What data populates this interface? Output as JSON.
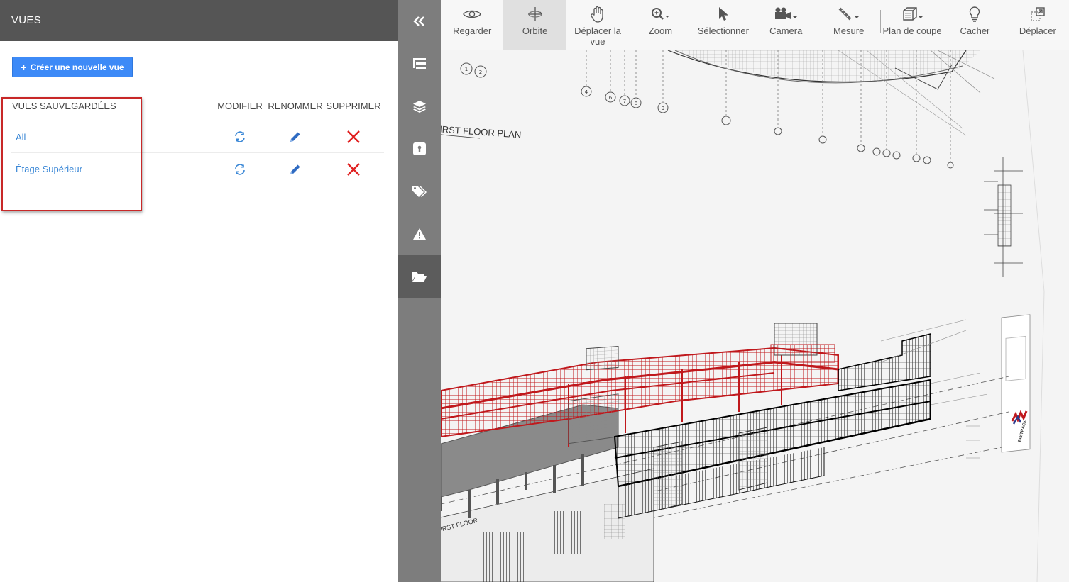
{
  "panel": {
    "title": "VUES",
    "create_button": "Créer une nouvelle vue",
    "table": {
      "headers": {
        "name": "VUES SAUVEGARDÉES",
        "modify": "MODIFIER",
        "rename": "RENOMMER",
        "delete": "SUPPRIMER"
      },
      "rows": [
        {
          "name": "All"
        },
        {
          "name": "Étage Supérieur"
        }
      ]
    }
  },
  "sidebar": {
    "items": [
      "collapse-icon",
      "tree-icon",
      "layers-icon",
      "lock-icon",
      "tags-icon",
      "warning-icon",
      "folder-open-icon"
    ],
    "active": "folder-open-icon"
  },
  "toolbar": {
    "tools": [
      {
        "id": "look",
        "label": "Regarder",
        "icon": "eye-icon"
      },
      {
        "id": "orbit",
        "label": "Orbite",
        "icon": "orbit-icon",
        "active": true
      },
      {
        "id": "pan",
        "label": "Déplacer la vue",
        "icon": "hand-icon"
      },
      {
        "id": "zoom",
        "label": "Zoom",
        "icon": "zoom-icon"
      },
      {
        "id": "select",
        "label": "Sélectionner",
        "icon": "cursor-icon"
      },
      {
        "id": "camera",
        "label": "Camera",
        "icon": "camera-icon"
      },
      {
        "id": "measure",
        "label": "Mesure",
        "icon": "ruler-icon"
      },
      {
        "id": "section",
        "label": "Plan de coupe",
        "icon": "section-box-icon"
      },
      {
        "id": "hide",
        "label": "Cacher",
        "icon": "bulb-icon"
      },
      {
        "id": "move",
        "label": "Déplacer",
        "icon": "move-icon"
      }
    ]
  },
  "viewport": {
    "drawing_labels": [
      "FIRST FLOOR PLAN",
      "FIRST FLOOR",
      "BIMTRACK"
    ]
  },
  "colors": {
    "header": "#555555",
    "sidebar": "#7d7d7d",
    "accent": "#3d8af7",
    "link": "#3a87d6",
    "delete": "#e02020",
    "highlight": "#c82828",
    "model_red": "#c0181c"
  }
}
